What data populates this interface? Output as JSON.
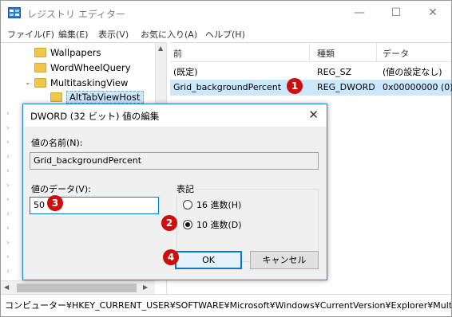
{
  "window": {
    "title": "レジストリ エディター",
    "controls": {
      "minimize": "—",
      "maximize": "☐",
      "close": "✕"
    }
  },
  "menu": [
    "ファイル(F)",
    "編集(E)",
    "表示(V)",
    "お気に入り(A)",
    "ヘルプ(H)"
  ],
  "tree": {
    "items": [
      {
        "label": "Wallpapers"
      },
      {
        "label": "WordWheelQuery"
      },
      {
        "label": "MultitaskingView"
      },
      {
        "label": "AltTabViewHost"
      }
    ]
  },
  "list": {
    "headers": [
      "前",
      "種類",
      "データ"
    ],
    "rows": [
      {
        "name": "(既定)",
        "type": "REG_SZ",
        "data": "(値の設定なし)"
      },
      {
        "name": "Grid_backgroundPercent",
        "type": "REG_DWORD",
        "data": "0x00000000 (0)"
      }
    ]
  },
  "badges": [
    "1",
    "2",
    "3",
    "4"
  ],
  "status_path": "コンピューター¥HKEY_CURRENT_USER¥SOFTWARE¥Microsoft¥Windows¥CurrentVersion¥Explorer¥Multitask",
  "dialog": {
    "title": "DWORD (32 ビット) 値の編集",
    "close": "✕",
    "value_name_label": "値の名前(N):",
    "value_name": "Grid_backgroundPercent",
    "value_data_label": "値のデータ(V):",
    "value_data": "50",
    "base_label": "表記",
    "radio_hex": "16 進数(H)",
    "radio_dec": "10 進数(D)",
    "selected_base": "10 進数(D)",
    "ok": "OK",
    "cancel": "キャンセル"
  },
  "colors": {
    "badge": "#cc0e0e",
    "accent": "#0078d7",
    "selection": "#cce8ff"
  }
}
